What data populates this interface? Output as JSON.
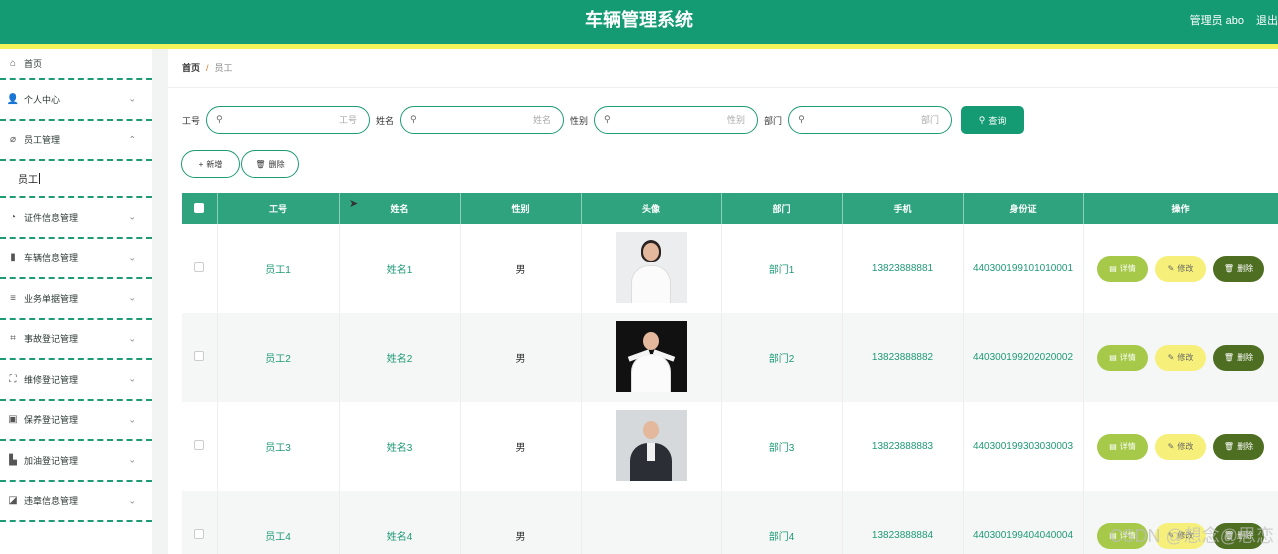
{
  "header": {
    "title": "车辆管理系统",
    "user_label": "管理员 abo",
    "logout_label": "退出"
  },
  "sidebar": {
    "items": [
      {
        "label": "首页",
        "icon": "home-icon",
        "has_chevron": false
      },
      {
        "label": "个人中心",
        "icon": "user-icon",
        "has_chevron": true
      },
      {
        "label": "员工管理",
        "icon": "leaf-icon",
        "has_chevron": true,
        "expanded": true
      }
    ],
    "sub_item": {
      "label": "员工"
    },
    "items2": [
      {
        "label": "证件信息管理",
        "icon": "gauge-icon"
      },
      {
        "label": "车辆信息管理",
        "icon": "bar-chart-icon"
      },
      {
        "label": "业务单据管理",
        "icon": "list-icon"
      },
      {
        "label": "事故登记管理",
        "icon": "crop-icon"
      },
      {
        "label": "维修登记管理",
        "icon": "frame-icon"
      },
      {
        "label": "保养登记管理",
        "icon": "chart-box-icon"
      },
      {
        "label": "加油登记管理",
        "icon": "factory-icon"
      },
      {
        "label": "违章信息管理",
        "icon": "area-chart-icon"
      }
    ]
  },
  "breadcrumb": {
    "home": "首页",
    "separator": "/",
    "current": "员工"
  },
  "search": {
    "fields": [
      {
        "label": "工号",
        "placeholder": "工号"
      },
      {
        "label": "姓名",
        "placeholder": "姓名"
      },
      {
        "label": "性别",
        "placeholder": "性别"
      },
      {
        "label": "部门",
        "placeholder": "部门"
      }
    ],
    "query_label": "查询"
  },
  "actions": {
    "add_label": "新增",
    "delete_label": "删除"
  },
  "table": {
    "columns": [
      "工号",
      "姓名",
      "性别",
      "头像",
      "部门",
      "手机",
      "身份证",
      "操作"
    ],
    "rows": [
      {
        "id": "员工1",
        "name": "姓名1",
        "gender": "男",
        "dept": "部门1",
        "phone": "13823888881",
        "idcard": "440300199101010001"
      },
      {
        "id": "员工2",
        "name": "姓名2",
        "gender": "男",
        "dept": "部门2",
        "phone": "13823888882",
        "idcard": "440300199202020002"
      },
      {
        "id": "员工3",
        "name": "姓名3",
        "gender": "男",
        "dept": "部门3",
        "phone": "13823888883",
        "idcard": "440300199303030003"
      },
      {
        "id": "员工4",
        "name": "姓名4",
        "gender": "男",
        "dept": "部门4",
        "phone": "13823888884",
        "idcard": "440300199404040004"
      }
    ],
    "row_actions": {
      "detail": "详情",
      "edit": "修改",
      "delete": "删除"
    }
  },
  "watermark": "CSDN @想念@思恋",
  "colors": {
    "primary": "#149b74",
    "stripe": "#f2f25a",
    "detail": "#a6c94a",
    "edit": "#f6f07a",
    "delete": "#4e6e22"
  }
}
